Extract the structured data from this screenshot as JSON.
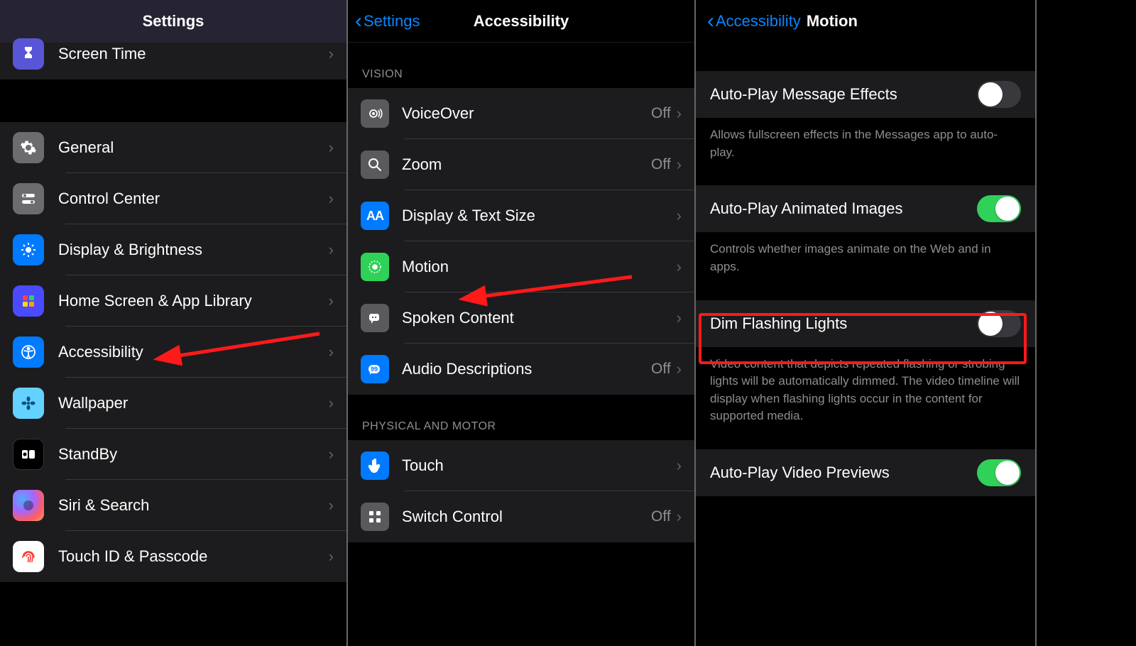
{
  "pane1": {
    "title": "Settings",
    "items": [
      {
        "label": "Screen Time"
      },
      {
        "label": "General"
      },
      {
        "label": "Control Center"
      },
      {
        "label": "Display & Brightness"
      },
      {
        "label": "Home Screen & App Library"
      },
      {
        "label": "Accessibility"
      },
      {
        "label": "Wallpaper"
      },
      {
        "label": "StandBy"
      },
      {
        "label": "Siri & Search"
      },
      {
        "label": "Touch ID & Passcode"
      }
    ]
  },
  "pane2": {
    "back": "Settings",
    "title": "Accessibility",
    "section_vision": "VISION",
    "section_motor": "PHYSICAL AND MOTOR",
    "vision": [
      {
        "label": "VoiceOver",
        "value": "Off"
      },
      {
        "label": "Zoom",
        "value": "Off"
      },
      {
        "label": "Display & Text Size",
        "value": ""
      },
      {
        "label": "Motion",
        "value": ""
      },
      {
        "label": "Spoken Content",
        "value": ""
      },
      {
        "label": "Audio Descriptions",
        "value": "Off"
      }
    ],
    "motor": [
      {
        "label": "Touch",
        "value": ""
      },
      {
        "label": "Switch Control",
        "value": "Off"
      }
    ]
  },
  "pane3": {
    "back": "Accessibility",
    "title": "Motion",
    "rows": {
      "autoplay_message": "Auto-Play Message Effects",
      "autoplay_message_desc": "Allows fullscreen effects in the Messages app to auto-play.",
      "autoplay_animated": "Auto-Play Animated Images",
      "autoplay_animated_desc": "Controls whether images animate on the Web and in apps.",
      "dim_flashing": "Dim Flashing Lights",
      "dim_flashing_desc": "Video content that depicts repeated flashing or strobing lights will be automatically dimmed. The video timeline will display when flashing lights occur in the content for supported media.",
      "autoplay_video": "Auto-Play Video Previews"
    },
    "toggles": {
      "autoplay_message": false,
      "autoplay_animated": true,
      "dim_flashing": false,
      "autoplay_video": true
    }
  }
}
